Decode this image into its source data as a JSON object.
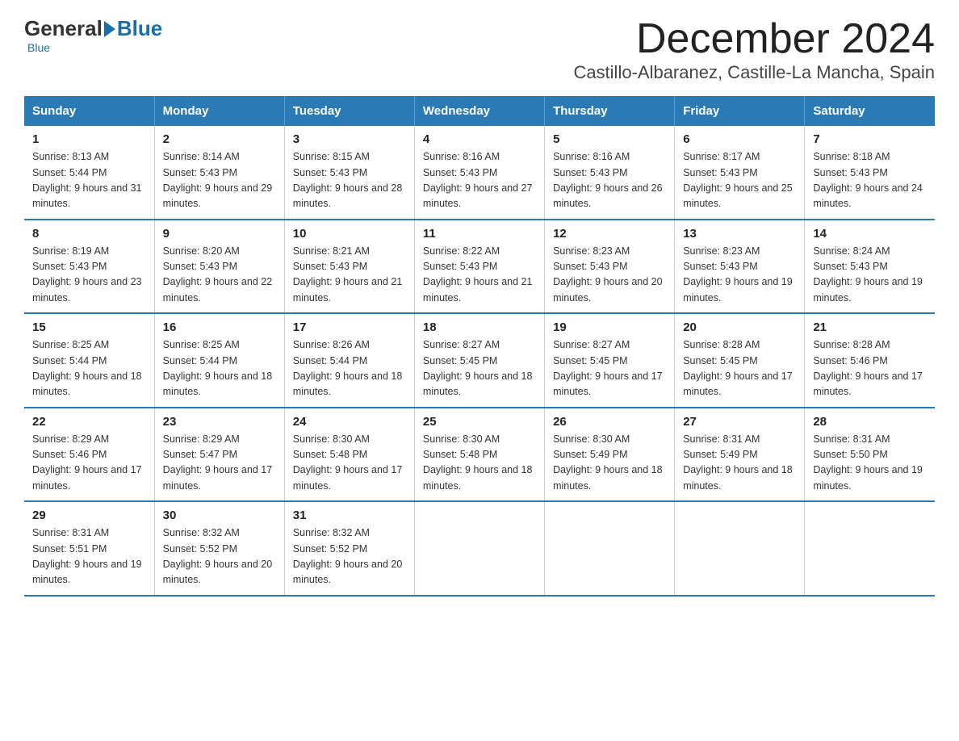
{
  "logo": {
    "general": "General",
    "blue": "Blue"
  },
  "header": {
    "month_year": "December 2024",
    "location": "Castillo-Albaranez, Castille-La Mancha, Spain"
  },
  "days_of_week": [
    "Sunday",
    "Monday",
    "Tuesday",
    "Wednesday",
    "Thursday",
    "Friday",
    "Saturday"
  ],
  "weeks": [
    [
      {
        "day": "1",
        "sunrise": "8:13 AM",
        "sunset": "5:44 PM",
        "daylight": "9 hours and 31 minutes."
      },
      {
        "day": "2",
        "sunrise": "8:14 AM",
        "sunset": "5:43 PM",
        "daylight": "9 hours and 29 minutes."
      },
      {
        "day": "3",
        "sunrise": "8:15 AM",
        "sunset": "5:43 PM",
        "daylight": "9 hours and 28 minutes."
      },
      {
        "day": "4",
        "sunrise": "8:16 AM",
        "sunset": "5:43 PM",
        "daylight": "9 hours and 27 minutes."
      },
      {
        "day": "5",
        "sunrise": "8:16 AM",
        "sunset": "5:43 PM",
        "daylight": "9 hours and 26 minutes."
      },
      {
        "day": "6",
        "sunrise": "8:17 AM",
        "sunset": "5:43 PM",
        "daylight": "9 hours and 25 minutes."
      },
      {
        "day": "7",
        "sunrise": "8:18 AM",
        "sunset": "5:43 PM",
        "daylight": "9 hours and 24 minutes."
      }
    ],
    [
      {
        "day": "8",
        "sunrise": "8:19 AM",
        "sunset": "5:43 PM",
        "daylight": "9 hours and 23 minutes."
      },
      {
        "day": "9",
        "sunrise": "8:20 AM",
        "sunset": "5:43 PM",
        "daylight": "9 hours and 22 minutes."
      },
      {
        "day": "10",
        "sunrise": "8:21 AM",
        "sunset": "5:43 PM",
        "daylight": "9 hours and 21 minutes."
      },
      {
        "day": "11",
        "sunrise": "8:22 AM",
        "sunset": "5:43 PM",
        "daylight": "9 hours and 21 minutes."
      },
      {
        "day": "12",
        "sunrise": "8:23 AM",
        "sunset": "5:43 PM",
        "daylight": "9 hours and 20 minutes."
      },
      {
        "day": "13",
        "sunrise": "8:23 AM",
        "sunset": "5:43 PM",
        "daylight": "9 hours and 19 minutes."
      },
      {
        "day": "14",
        "sunrise": "8:24 AM",
        "sunset": "5:43 PM",
        "daylight": "9 hours and 19 minutes."
      }
    ],
    [
      {
        "day": "15",
        "sunrise": "8:25 AM",
        "sunset": "5:44 PM",
        "daylight": "9 hours and 18 minutes."
      },
      {
        "day": "16",
        "sunrise": "8:25 AM",
        "sunset": "5:44 PM",
        "daylight": "9 hours and 18 minutes."
      },
      {
        "day": "17",
        "sunrise": "8:26 AM",
        "sunset": "5:44 PM",
        "daylight": "9 hours and 18 minutes."
      },
      {
        "day": "18",
        "sunrise": "8:27 AM",
        "sunset": "5:45 PM",
        "daylight": "9 hours and 18 minutes."
      },
      {
        "day": "19",
        "sunrise": "8:27 AM",
        "sunset": "5:45 PM",
        "daylight": "9 hours and 17 minutes."
      },
      {
        "day": "20",
        "sunrise": "8:28 AM",
        "sunset": "5:45 PM",
        "daylight": "9 hours and 17 minutes."
      },
      {
        "day": "21",
        "sunrise": "8:28 AM",
        "sunset": "5:46 PM",
        "daylight": "9 hours and 17 minutes."
      }
    ],
    [
      {
        "day": "22",
        "sunrise": "8:29 AM",
        "sunset": "5:46 PM",
        "daylight": "9 hours and 17 minutes."
      },
      {
        "day": "23",
        "sunrise": "8:29 AM",
        "sunset": "5:47 PM",
        "daylight": "9 hours and 17 minutes."
      },
      {
        "day": "24",
        "sunrise": "8:30 AM",
        "sunset": "5:48 PM",
        "daylight": "9 hours and 17 minutes."
      },
      {
        "day": "25",
        "sunrise": "8:30 AM",
        "sunset": "5:48 PM",
        "daylight": "9 hours and 18 minutes."
      },
      {
        "day": "26",
        "sunrise": "8:30 AM",
        "sunset": "5:49 PM",
        "daylight": "9 hours and 18 minutes."
      },
      {
        "day": "27",
        "sunrise": "8:31 AM",
        "sunset": "5:49 PM",
        "daylight": "9 hours and 18 minutes."
      },
      {
        "day": "28",
        "sunrise": "8:31 AM",
        "sunset": "5:50 PM",
        "daylight": "9 hours and 19 minutes."
      }
    ],
    [
      {
        "day": "29",
        "sunrise": "8:31 AM",
        "sunset": "5:51 PM",
        "daylight": "9 hours and 19 minutes."
      },
      {
        "day": "30",
        "sunrise": "8:32 AM",
        "sunset": "5:52 PM",
        "daylight": "9 hours and 20 minutes."
      },
      {
        "day": "31",
        "sunrise": "8:32 AM",
        "sunset": "5:52 PM",
        "daylight": "9 hours and 20 minutes."
      },
      null,
      null,
      null,
      null
    ]
  ]
}
